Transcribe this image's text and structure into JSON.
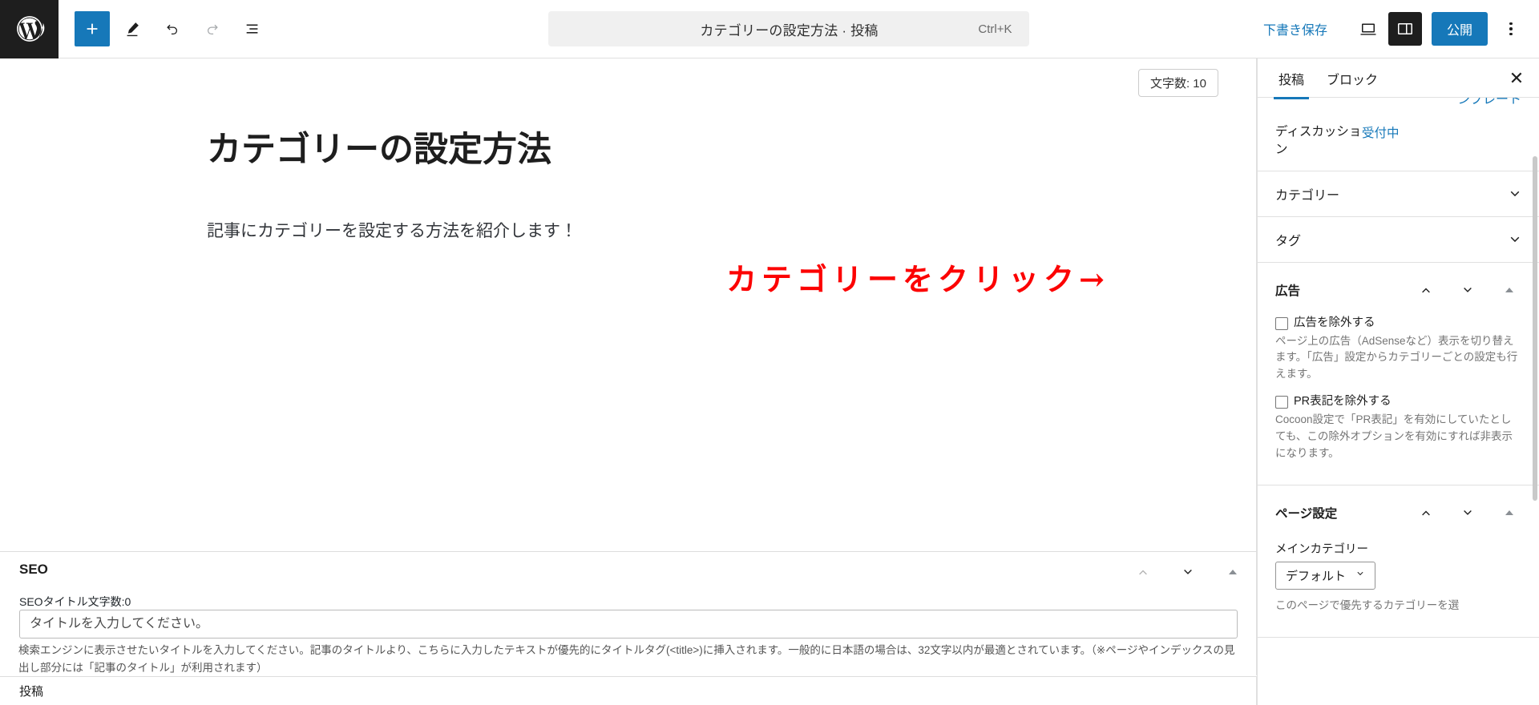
{
  "header": {
    "logo_icon": "wordpress-logo-icon",
    "tools": [
      {
        "name": "add-block-button",
        "icon": "plus-icon",
        "label": "ブロックを追加"
      },
      {
        "name": "edit-tool-button",
        "icon": "pencil-icon",
        "label": "ツール"
      },
      {
        "name": "undo-button",
        "icon": "undo-icon",
        "label": "元に戻す"
      },
      {
        "name": "redo-button",
        "icon": "redo-icon",
        "label": "やり直し"
      },
      {
        "name": "document-overview-button",
        "icon": "list-view-icon",
        "label": "ドキュメント概観"
      }
    ],
    "command_bar": {
      "title": "カテゴリーの設定方法 · 投稿",
      "shortcut": "Ctrl+K"
    },
    "save_draft_label": "下書き保存",
    "preview_icon": "laptop-preview-icon",
    "settings_sidebar_icon": "sidebar-panel-icon",
    "publish_label": "公開",
    "options_icon": "kebab-menu-icon"
  },
  "editor": {
    "word_count_badge": "文字数: 10",
    "post_title": "カテゴリーの設定方法",
    "paragraph": "記事にカテゴリーを設定する方法を紹介します！",
    "annotation": "カテゴリーをクリック→",
    "annotation_color": "#fc0202"
  },
  "seo_panel": {
    "title": "SEO",
    "char_count_label": "SEOタイトル文字数:0",
    "input_value": "",
    "input_placeholder": "タイトルを入力してください。",
    "description": "検索エンジンに表示させたいタイトルを入力してください。記事のタイトルより、こちらに入力したテキストが優先的にタイトルタグ(<title>)に挿入されます。一般的に日本語の場合は、32文字以内が最適とされています。（※ページやインデックスの見出し部分には「記事のタイトル」が利用されます）",
    "icons": [
      "chevron-up-icon",
      "chevron-down-icon",
      "triangle-up-icon"
    ]
  },
  "status_bar": {
    "label": "投稿"
  },
  "sidebar": {
    "tabs": [
      {
        "label": "投稿",
        "active": true
      },
      {
        "label": "ブロック",
        "active": false
      }
    ],
    "close_icon": "close-icon",
    "clipped_link": "ンプレート",
    "rows": [
      {
        "label": "ディスカッション",
        "value": "受付中"
      }
    ],
    "accordions": [
      {
        "label": "カテゴリー",
        "icon": "chevron-down-icon"
      },
      {
        "label": "タグ",
        "icon": "chevron-down-icon"
      }
    ],
    "ad_panel": {
      "title": "広告",
      "icons": [
        "chevron-up-icon",
        "chevron-down-icon",
        "triangle-up-icon"
      ],
      "checkboxes": [
        {
          "label": "広告を除外する",
          "checked": false,
          "help": "ページ上の広告（AdSenseなど）表示を切り替えます。「広告」設定からカテゴリーごとの設定も行えます。"
        },
        {
          "label": "PR表記を除外する",
          "checked": false,
          "help": "Cocoon設定で「PR表記」を有効にしていたとしても、この除外オプションを有効にすれば非表示になります。"
        }
      ]
    },
    "page_panel": {
      "title": "ページ設定",
      "icons": [
        "chevron-up-icon",
        "chevron-down-icon",
        "triangle-up-icon"
      ],
      "field_label": "メインカテゴリー",
      "select_value": "デフォルト",
      "select_icon": "chevron-down-icon",
      "help": "このページで優先するカテゴリーを選"
    }
  },
  "colors": {
    "accent": "#1678b9",
    "dark": "#1e1e1e",
    "border": "#e0e0e0",
    "muted": "#757575"
  }
}
